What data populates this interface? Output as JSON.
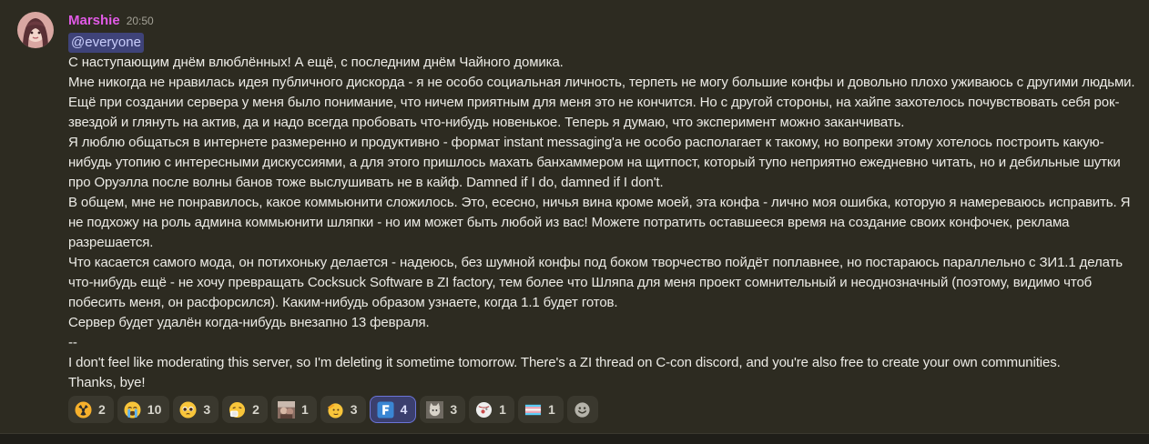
{
  "message": {
    "author": "Marshie",
    "timestamp": "20:50",
    "author_color": "#e15ae6",
    "mention": "@everyone",
    "paragraphs": [
      "С наступающим днём влюблённых! А ещё, с последним днём Чайного домика.",
      "Мне никогда не нравилась идея публичного дискорда - я не особо социальная личность, терпеть не могу большие конфы и довольно плохо уживаюсь с другими людьми. Ещё при создании сервера у меня было понимание, что ничем приятным для меня это не кончится. Но с другой стороны, на хайпе захотелось почувствовать себя рок-звездой и глянуть на актив, да и надо всегда пробовать что-нибудь новенькое. Теперь я думаю, что эксперимент можно заканчивать.",
      "Я люблю общаться в интернете размеренно и продуктивно - формат instant messaging'а не особо располагает к такому, но вопреки этому хотелось построить какую-нибудь утопию с интересными дискуссиями, а для этого пришлось махать банхаммером на щитпост, который тупо неприятно ежедневно читать, но и дебильные шутки про Оруэлла после волны банов тоже выслушивать не в кайф. Damned if I do, damned if I don't.",
      "В общем, мне не понравилось, какое коммьюнити сложилось. Это, есесно, ничья вина кроме моей, эта конфа - лично моя ошибка, которую я намереваюсь исправить. Я не подхожу на роль админа коммьюнити шляпки - но им может быть любой из вас! Можете потратить оставшееся время на создание своих конфочек, реклама разрешается.",
      "Что касается самого мода, он потихоньку делается - надеюсь, без шумной конфы под боком творчество пойдёт поплавнее, но постараюсь параллельно с ЗИ1.1 делать что-нибудь ещё - не хочу превращать Cocksuck Software в ZI factory, тем более что Шляпа для меня проект сомнительный и неоднозначный (поэтому, видимо чтоб побесить меня, он расфорсился). Каким-нибудь образом узнаете, когда 1.1 будет готов.",
      "Сервер будет удалён когда-нибудь внезапно 13 февраля.",
      "--",
      "I don't feel like moderating this server, so I'm deleting it  sometime tomorrow. There's a ZI thread on C-con discord, and you're also free to create your own communities.",
      "Thanks, bye!"
    ]
  },
  "reactions": [
    {
      "icon": "radioactive-icon",
      "count": "2",
      "active": false
    },
    {
      "icon": "sob-icon",
      "count": "10",
      "active": false
    },
    {
      "icon": "pleading-face-icon",
      "count": "3",
      "active": false
    },
    {
      "icon": "sneezing-face-icon",
      "count": "2",
      "active": false
    },
    {
      "icon": "custom-image-emoji-icon",
      "count": "1",
      "active": false
    },
    {
      "icon": "saluting-face-icon",
      "count": "3",
      "active": false
    },
    {
      "icon": "letter-f-icon",
      "count": "4",
      "active": true,
      "label": "F"
    },
    {
      "icon": "custom-cat-emoji-icon",
      "count": "3",
      "active": false
    },
    {
      "icon": "custom-ball-emoji-icon",
      "count": "1",
      "active": false
    },
    {
      "icon": "trans-flag-icon",
      "count": "1",
      "active": false
    }
  ],
  "add_reaction": {
    "icon": "add-reaction-icon"
  }
}
